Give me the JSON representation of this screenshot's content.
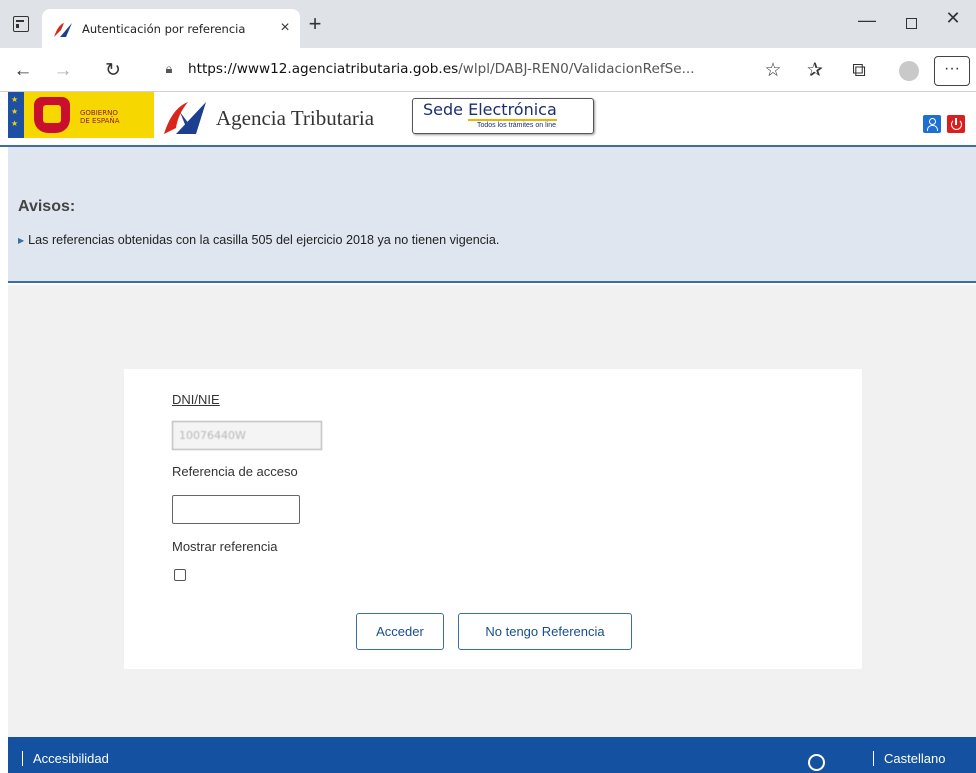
{
  "browser": {
    "tab_title": "Autenticación por referencia",
    "tab_close": "×",
    "new_tab": "+",
    "url_domain": "https://www12.agenciatributaria.gob.es",
    "url_path": "/wlpl/DABJ-REN0/ValidacionRefSe...",
    "menu": "···"
  },
  "header": {
    "gov_text_line1": "GOBIERNO",
    "gov_text_line2": "DE ESPAÑA",
    "agency_name": "Agencia Tributaria",
    "sede_title_pre": "Sede ",
    "sede_title_main": "Electrónica",
    "sede_subtitle": "Todos los trámites on line"
  },
  "avisos": {
    "title": "Avisos:",
    "items": [
      "Las referencias obtenidas con la casilla 505 del ejercicio 2018 ya no tienen vigencia."
    ]
  },
  "form": {
    "dni_label": "DNI/NIE",
    "dni_value": "10076440W",
    "ref_label": "Referencia de acceso",
    "ref_value": "",
    "show_label": "Mostrar referencia",
    "show_checked": false,
    "acceder_label": "Acceder",
    "noref_label": "No tengo Referencia"
  },
  "footer": {
    "accessibility": "Accesibilidad",
    "language": "Castellano"
  },
  "icons": {
    "window": "window-icon",
    "back": "back-arrow-icon",
    "forward": "forward-arrow-icon",
    "refresh": "refresh-icon",
    "lock": "lock-icon",
    "add_favorite": "add-favorite-icon",
    "favorites": "favorites-icon",
    "collections": "collections-icon",
    "profile": "profile-icon",
    "user": "user-icon",
    "power": "power-icon",
    "search": "search-icon"
  },
  "colors": {
    "tab_bar": "#dfe3e8",
    "header_rule": "#3a6ea5",
    "avisos_bg": "#dfe6ef",
    "footer_bg": "#1451a0",
    "flag_blue": "#1d4fa3",
    "gov_yellow": "#f7d700",
    "user_button": "#1e6fd0",
    "power_button": "#d91e1e"
  }
}
